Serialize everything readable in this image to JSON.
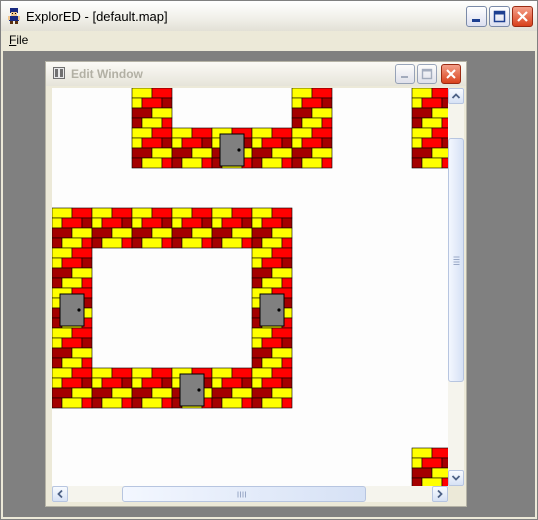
{
  "app": {
    "title": "ExplorED - [default.map]",
    "icon": "app-character-icon"
  },
  "caption_buttons": {
    "minimize": "minimize-icon",
    "maximize": "maximize-icon",
    "close": "close-icon"
  },
  "menu": {
    "file_accel": "F",
    "file_rest": "ile"
  },
  "child_window": {
    "title": "Edit Window",
    "icon": "document-icon"
  },
  "map": {
    "tile_size": 40,
    "wall_colors": {
      "red": "#ff0000",
      "yellow": "#ffff00",
      "dark_red": "#a40000",
      "mortar": "#000000"
    },
    "door_color": "#808080",
    "background": "#fdfdfd",
    "rows": [
      "  W   W  W   ",
      "  WWDWW  WWWW",
      "             ",
      "WWWWWW       ",
      "W    W    WWW",
      "D    D       ",
      "W    W    WWW",
      "WWWDWW       ",
      "             ",
      "         W  W"
    ]
  },
  "scrollbars": {
    "vertical_position": 0.28,
    "horizontal_position": 0.45
  }
}
